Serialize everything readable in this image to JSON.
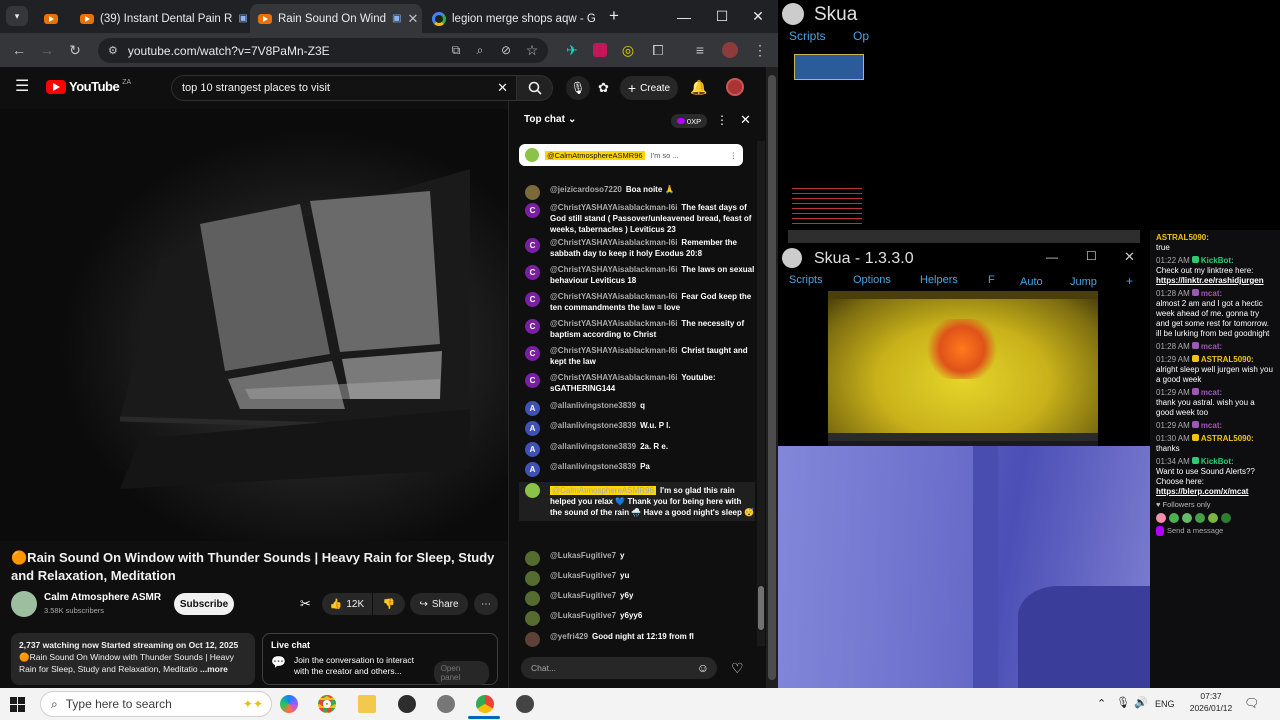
{
  "tabs": [
    {
      "label": ""
    },
    {
      "label": "(39) Instant Dental Pain R"
    },
    {
      "label": "Rain Sound On Wind"
    },
    {
      "label": "legion merge shops aqw - G"
    }
  ],
  "address": {
    "url": "youtube.com/watch?v=7V8PaMn-Z3E"
  },
  "youtube": {
    "logo": "YouTube",
    "region": "ZA",
    "search_value": "top 10 strangest places to visit",
    "create_label": "Create"
  },
  "video": {
    "title": "🟠Rain Sound On Window with Thunder Sounds | Heavy Rain for Sleep, Study and Relaxation, Meditation",
    "channel": "Calm Atmosphere ASMR",
    "subscribers": "3.58K subscribers",
    "subscribe_label": "Subscribe",
    "likes": "12K",
    "share_label": "Share",
    "desc_stats": "2,737 watching now  Started streaming on Oct 12, 2025",
    "desc_text": "🟠Rain Sound On Window with Thunder Sounds | Heavy Rain for Sleep, Study and Relaxation, Meditatio",
    "more": "...more"
  },
  "live_chat_box": {
    "title": "Live chat",
    "text": "Join the conversation to interact with the creator and others...",
    "button": "Open panel"
  },
  "chat": {
    "header": "Top chat",
    "points": "0XP",
    "pinned_author": "@CalmAtmosphereASMR96",
    "pinned_text": "I'm so ...",
    "input_placeholder": "Chat...",
    "messages": [
      {
        "author": "@jeizicardoso7220",
        "text": "Boa noite 🙏",
        "avatar": "",
        "color": "#7a6a3a"
      },
      {
        "author": "@ChristYASHAYAisablackman-l6i",
        "text": "The feast days of God still stand ( Passover/unleavened bread, feast of weeks, tabernacles ) Leviticus 23",
        "avatar": "C",
        "color": "#7b1fa2"
      },
      {
        "author": "@ChristYASHAYAisablackman-l6i",
        "text": "Remember the sabbath day to keep it holy Exodus 20:8",
        "avatar": "C",
        "color": "#7b1fa2"
      },
      {
        "author": "@ChristYASHAYAisablackman-l6i",
        "text": "The laws on sexual behaviour Leviticus 18",
        "avatar": "C",
        "color": "#7b1fa2"
      },
      {
        "author": "@ChristYASHAYAisablackman-l6i",
        "text": "Fear God keep the ten commandments the law = love",
        "avatar": "C",
        "color": "#7b1fa2"
      },
      {
        "author": "@ChristYASHAYAisablackman-l6i",
        "text": "The necessity of baptism according to Christ",
        "avatar": "C",
        "color": "#7b1fa2"
      },
      {
        "author": "@ChristYASHAYAisablackman-l6i",
        "text": "Christ taught and kept the law",
        "avatar": "C",
        "color": "#7b1fa2"
      },
      {
        "author": "@ChristYASHAYAisablackman-l6i",
        "text": "Youtube: sGATHERING144",
        "avatar": "C",
        "color": "#7b1fa2"
      },
      {
        "author": "@allanlivingstone3839",
        "text": "q",
        "avatar": "A",
        "color": "#3f51b5"
      },
      {
        "author": "@allanlivingstone3839",
        "text": "W.u. P l.",
        "avatar": "A",
        "color": "#3f51b5"
      },
      {
        "author": "@allanlivingstone3839",
        "text": "2a. R e.",
        "avatar": "A",
        "color": "#3f51b5"
      },
      {
        "author": "@allanlivingstone3839",
        "text": "Pa",
        "avatar": "A",
        "color": "#3f51b5"
      },
      {
        "author": "@CalmAtmosphereASMR96",
        "text": "I'm so glad this rain helped you relax 💙 Thank you for being here with the sound of the rain 🌧️ Have a good night's sleep 😴",
        "avatar": "",
        "color": "#8bc34a",
        "owner": true
      },
      {
        "author": "@LukasFugitive7",
        "text": "y",
        "avatar": "",
        "color": "#556b2f"
      },
      {
        "author": "@LukasFugitive7",
        "text": "yu",
        "avatar": "",
        "color": "#556b2f"
      },
      {
        "author": "@LukasFugitive7",
        "text": "y6y",
        "avatar": "",
        "color": "#556b2f"
      },
      {
        "author": "@LukasFugitive7",
        "text": "y6yy6",
        "avatar": "",
        "color": "#556b2f"
      },
      {
        "author": "@yefri429",
        "text": "Good night at 12:19 from fl",
        "avatar": "",
        "color": "#5d4037"
      }
    ]
  },
  "skua": {
    "title1": "Skua",
    "menu1": [
      "Scripts",
      "Op"
    ],
    "title2": "Skua - 1.3.3.0",
    "menu2": [
      "Scripts",
      "Options",
      "Helpers",
      "F",
      "Auto",
      "Jump",
      "+"
    ]
  },
  "twitch": {
    "top": {
      "user": "ASTRAL5090:",
      "text": "true"
    },
    "messages": [
      {
        "time": "01:22 AM",
        "user": "KickBot:",
        "color": "#2ecc71",
        "text": "Check out my linktree here:",
        "link": "https://linktr.ee/rashidjurgen"
      },
      {
        "time": "01:28 AM",
        "user": "mcat:",
        "color": "#9b59b6",
        "text": "almost 2 am and I got a hectic week ahead of me. gonna try and get some rest for tomorrow. ill be lurking from bed goodnight",
        "link": ""
      },
      {
        "time": "01:28 AM",
        "user": "mcat:",
        "color": "#9b59b6",
        "text": "",
        "link": ""
      },
      {
        "time": "01:29 AM",
        "user": "ASTRAL5090:",
        "color": "#f1c40f",
        "text": "alright sleep well jurgen wish you a good week",
        "link": ""
      },
      {
        "time": "01:29 AM",
        "user": "mcat:",
        "color": "#9b59b6",
        "text": "thank you astral. wish you a good week too",
        "link": ""
      },
      {
        "time": "01:29 AM",
        "user": "mcat:",
        "color": "#9b59b6",
        "text": "",
        "link": ""
      },
      {
        "time": "01:30 AM",
        "user": "ASTRAL5090:",
        "color": "#f1c40f",
        "text": "thanks",
        "link": ""
      },
      {
        "time": "01:34 AM",
        "user": "KickBot:",
        "color": "#2ecc71",
        "text": "Want to use Sound Alerts?? Choose here:",
        "link": "https://blerp.com/x/mcat"
      }
    ],
    "followers_only": "Followers only",
    "send": "Send a message"
  },
  "taskbar": {
    "search": "Type here to search",
    "lang": "ENG",
    "time": "07:37",
    "date": "2026/01/12"
  }
}
